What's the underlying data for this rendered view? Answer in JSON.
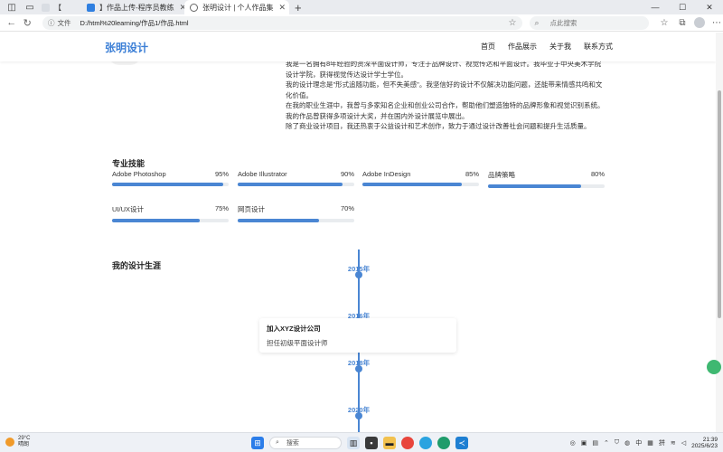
{
  "browser": {
    "tabs": [
      {
        "label": "【",
        "active": false
      },
      {
        "label": "】作品上传-程序员教练",
        "active": false
      },
      {
        "label": "张明设计 | 个人作品集",
        "active": true
      }
    ],
    "address": {
      "file_label": "文件",
      "url": "D:/html%20learning/作品1/作品.html",
      "search_placeholder": "点此搜索"
    }
  },
  "site": {
    "logo": "张明设计",
    "nav": [
      "首页",
      "作品展示",
      "关于我",
      "联系方式"
    ]
  },
  "bio": [
    "我是一名拥有8年经验的资深平面设计师，专注于品牌设计、视觉传达和平面设计。我毕业于中央美术学院设计学院，获得视觉传达设计学士学位。",
    "我的设计理念是\"形式追随功能，但不失美感\"。我坚信好的设计不仅解决功能问题，还能带来情感共鸣和文化价值。",
    "在我的职业生涯中，我曾与多家知名企业和创业公司合作，帮助他们塑造独特的品牌形象和视觉识别系统。我的作品曾获得多项设计大奖，并在国内外设计展览中展出。",
    "除了商业设计项目，我还热衷于公益设计和艺术创作，致力于通过设计改善社会问题和提升生活质量。"
  ],
  "skills": {
    "title": "专业技能",
    "items": [
      {
        "name": "Adobe Photoshop",
        "percent": "95%",
        "level": 95
      },
      {
        "name": "Adobe Illustrator",
        "percent": "90%",
        "level": 90
      },
      {
        "name": "Adobe InDesign",
        "percent": "85%",
        "level": 85
      },
      {
        "name": "品牌策略",
        "percent": "80%",
        "level": 80
      },
      {
        "name": "UI/UX设计",
        "percent": "75%",
        "level": 75
      },
      {
        "name": "网页设计",
        "percent": "70%",
        "level": 70
      }
    ]
  },
  "timeline": {
    "title": "我的设计生涯",
    "years": [
      "2015年",
      "2016年",
      "2018年",
      "2020年"
    ],
    "card": {
      "title": "加入XYZ设计公司",
      "desc": "担任初级平面设计师"
    }
  },
  "taskbar": {
    "weather_temp": "29°C",
    "weather_desc": "晴朗",
    "search_label": "搜索",
    "ime_lang": "中",
    "ime_mode": "拼",
    "time": "21:39",
    "date": "2025/6/23"
  },
  "colors": {
    "accent": "#4a86d3",
    "logo": "#3c7fd6"
  }
}
